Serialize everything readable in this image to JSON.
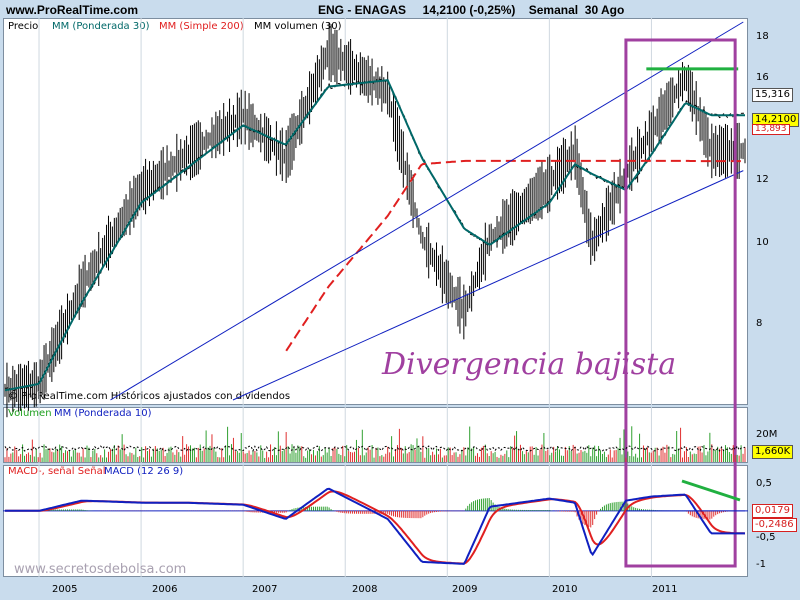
{
  "header": {
    "site": "www.ProRealTime.com",
    "title": "ENG - ENAGAS     14,2100 (-0,25%)    Semanal  30 Ago"
  },
  "legend_price": {
    "precio": "Precio",
    "mm30": "MM (Ponderada 30)",
    "mm200": "MM (Simple 200)",
    "mmvol": "MM volumen (30)"
  },
  "watermark": "© ProRealTime.com Históricos ajustados con dividendos",
  "annotation": "Divergencia bajista",
  "legend_volume": {
    "volumen": "Volumen",
    "mm10": "MM (Ponderada 10)"
  },
  "legend_macd": {
    "macd": "MACD-, señal Señal",
    "macd2": "MACD (12 26 9)"
  },
  "footer_site": "www.secretosdebolsa.com",
  "price_axis": {
    "ticks": [
      "18",
      "16",
      "14",
      "12",
      "10",
      "8"
    ]
  },
  "price_tags": [
    {
      "text": "15,316",
      "bg": "#ffffff",
      "color": "#000000"
    },
    {
      "text": "14,2100",
      "bg": "#ffff00",
      "color": "#000000"
    },
    {
      "text": "13,893",
      "bg": "#ffffff",
      "color": "#d62020"
    }
  ],
  "volume_axis": {
    "tick": "20M",
    "tag": "1,660K"
  },
  "macd_axis": {
    "ticks": [
      "0,5",
      "0",
      "-0,5",
      "-1"
    ],
    "tag1": "0,0179",
    "tag2": "-0,2486"
  },
  "x_axis": {
    "labels": [
      "2005",
      "2006",
      "2007",
      "2008",
      "2009",
      "2010",
      "2011"
    ]
  },
  "colors": {
    "price": "#000000",
    "mm30": "#006868",
    "mm200": "#e02020",
    "mmvol": "#000000",
    "trend": "#1020c0",
    "highlight": "#a040a0",
    "resistance": "#20b040",
    "annotation": "#a040a0"
  },
  "chart_data": {
    "type": "line",
    "x": [
      "2004-09",
      "2005-01",
      "2005-06",
      "2006-01",
      "2006-06",
      "2007-01",
      "2007-06",
      "2007-11",
      "2008-06",
      "2008-10",
      "2009-03",
      "2009-06",
      "2010-01",
      "2010-04",
      "2010-06",
      "2010-10",
      "2011-01",
      "2011-05",
      "2011-08"
    ],
    "series": [
      {
        "name": "Precio",
        "values": [
          6.8,
          7.0,
          10.0,
          13.0,
          14.0,
          15.3,
          14.0,
          17.3,
          16.0,
          11.5,
          9.2,
          11.5,
          13.2,
          14.2,
          11.3,
          13.5,
          14.8,
          16.5,
          14.21
        ]
      },
      {
        "name": "MM (Ponderada 30)",
        "values": [
          6.8,
          7.0,
          9.5,
          12.6,
          13.6,
          15.0,
          14.4,
          16.2,
          16.4,
          14.0,
          11.8,
          11.3,
          12.6,
          13.8,
          13.5,
          13.0,
          14.1,
          15.7,
          15.316
        ]
      },
      {
        "name": "MM (Simple 200)",
        "values": [
          null,
          null,
          null,
          null,
          null,
          null,
          8.0,
          10.0,
          12.2,
          13.8,
          13.9,
          13.9,
          13.9,
          13.9,
          13.9,
          13.9,
          13.9,
          13.9,
          13.893
        ]
      }
    ],
    "ylim": [
      6.5,
      18.2
    ],
    "macd": {
      "ylim": [
        -1.1,
        0.7
      ],
      "last_macd": 0.0179,
      "last_signal": -0.2486
    }
  }
}
